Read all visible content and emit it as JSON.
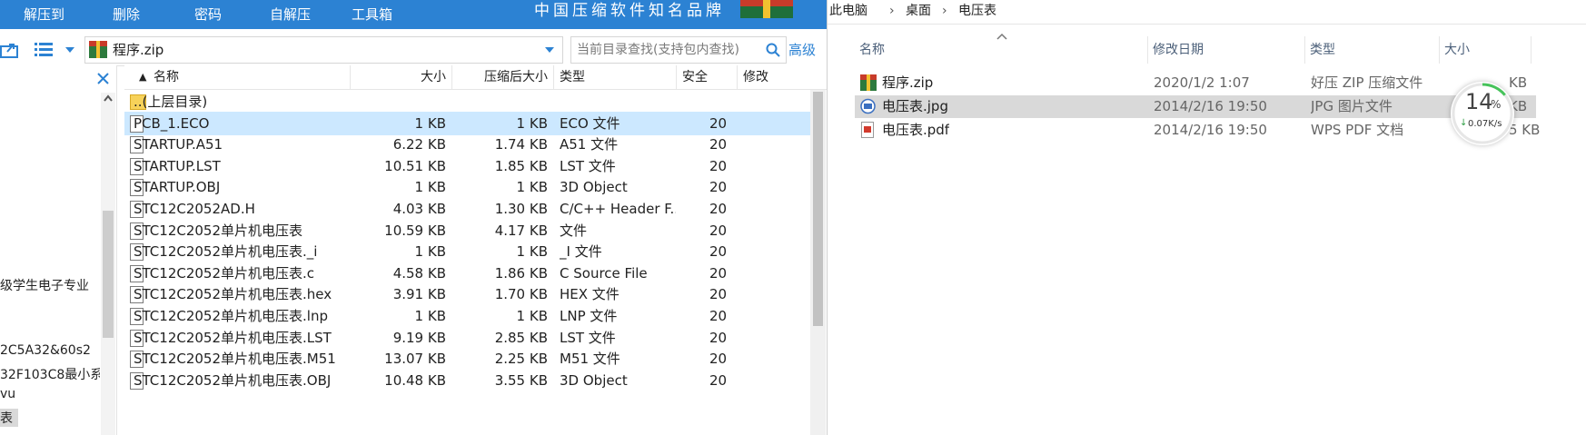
{
  "haozip": {
    "toolbar": {
      "extract_to": "解压到",
      "delete": "删除",
      "password": "密码",
      "self_extract": "自解压",
      "toolbox": "工具箱",
      "brand": "中国压缩软件知名品牌"
    },
    "address": {
      "path": "程序.zip",
      "search_placeholder": "当前目录查找(支持包内查找)",
      "advanced": "高级"
    },
    "tree_items": [
      "级学生电子专业",
      "2C5A32&60s2",
      "32F103C8最小系",
      "vu",
      "表"
    ],
    "columns": {
      "name": "名称",
      "size": "大小",
      "packed": "压缩后大小",
      "type": "类型",
      "security": "安全",
      "modified": "修改"
    },
    "rows": [
      {
        "name": "..(上层目录)",
        "size": "",
        "packed": "",
        "type": "",
        "mod": ""
      },
      {
        "name": "PCB_1.ECO",
        "size": "1 KB",
        "packed": "1 KB",
        "type": "ECO 文件",
        "mod": "20"
      },
      {
        "name": "STARTUP.A51",
        "size": "6.22 KB",
        "packed": "1.74 KB",
        "type": "A51 文件",
        "mod": "20"
      },
      {
        "name": "STARTUP.LST",
        "size": "10.51 KB",
        "packed": "1.85 KB",
        "type": "LST 文件",
        "mod": "20"
      },
      {
        "name": "STARTUP.OBJ",
        "size": "1 KB",
        "packed": "1 KB",
        "type": "3D Object",
        "mod": "20"
      },
      {
        "name": "STC12C2052AD.H",
        "size": "4.03 KB",
        "packed": "1.30 KB",
        "type": "C/C++ Header F...",
        "mod": "20"
      },
      {
        "name": "STC12C2052单片机电压表",
        "size": "10.59 KB",
        "packed": "4.17 KB",
        "type": "文件",
        "mod": "20"
      },
      {
        "name": "STC12C2052单片机电压表._i",
        "size": "1 KB",
        "packed": "1 KB",
        "type": "_I 文件",
        "mod": "20"
      },
      {
        "name": "STC12C2052单片机电压表.c",
        "size": "4.58 KB",
        "packed": "1.86 KB",
        "type": "C Source File",
        "mod": "20"
      },
      {
        "name": "STC12C2052单片机电压表.hex",
        "size": "3.91 KB",
        "packed": "1.70 KB",
        "type": "HEX 文件",
        "mod": "20"
      },
      {
        "name": "STC12C2052单片机电压表.lnp",
        "size": "1 KB",
        "packed": "1 KB",
        "type": "LNP 文件",
        "mod": "20"
      },
      {
        "name": "STC12C2052单片机电压表.LST",
        "size": "9.19 KB",
        "packed": "2.85 KB",
        "type": "LST 文件",
        "mod": "20"
      },
      {
        "name": "STC12C2052单片机电压表.M51",
        "size": "13.07 KB",
        "packed": "2.25 KB",
        "type": "M51 文件",
        "mod": "20"
      },
      {
        "name": "STC12C2052单片机电压表.OBJ",
        "size": "10.48 KB",
        "packed": "3.55 KB",
        "type": "3D Object",
        "mod": "20"
      }
    ]
  },
  "explorer": {
    "breadcrumb": [
      "此电脑",
      "桌面",
      "电压表"
    ],
    "columns": {
      "name": "名称",
      "modified": "修改日期",
      "type": "类型",
      "size": "大小"
    },
    "files": [
      {
        "name": "程序.zip",
        "modified": "2020/1/2 1:07",
        "type": "好压 ZIP 压缩文件",
        "size": "KB"
      },
      {
        "name": "电压表.jpg",
        "modified": "2014/2/16 19:50",
        "type": "JPG 图片文件",
        "size": "KB"
      },
      {
        "name": "电压表.pdf",
        "modified": "2014/2/16 19:50",
        "type": "WPS PDF 文档",
        "size": "5 KB"
      }
    ]
  },
  "speed_widget": {
    "percent": "14",
    "percent_sign": "%",
    "speed": "0.07K/s",
    "usage": 0.14
  }
}
